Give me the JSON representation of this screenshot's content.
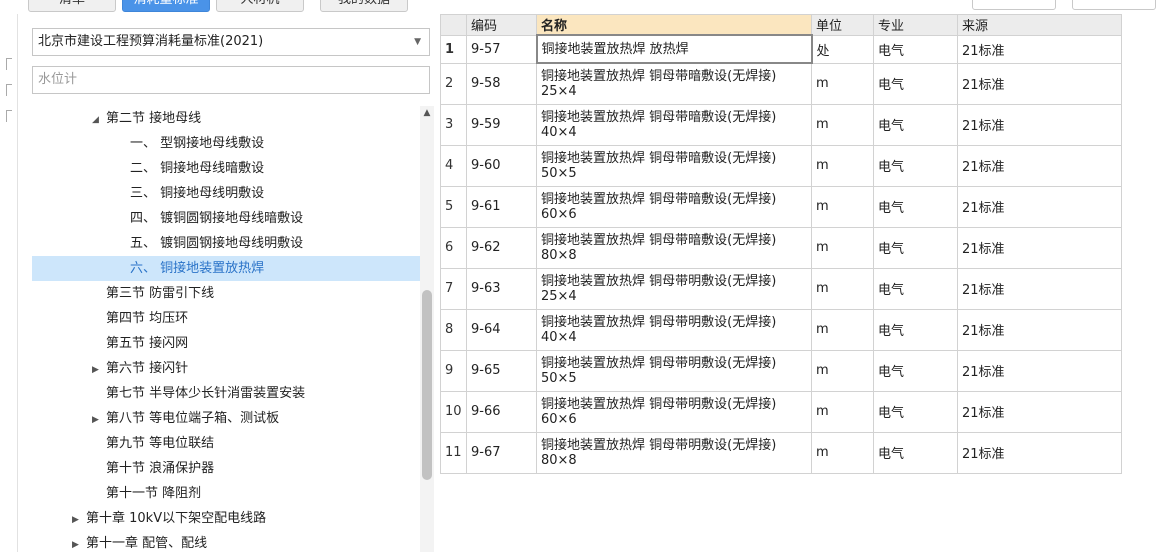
{
  "tabs": [
    "清单",
    "消耗量标准",
    "人材机",
    "我的数据"
  ],
  "quota_select": {
    "value": "北京市建设工程预算消耗量标准(2021)"
  },
  "search": {
    "placeholder": "水位计"
  },
  "tree": [
    {
      "label": "第二节 接地母线",
      "level": 1,
      "toggle": "expanded"
    },
    {
      "label": "一、 型钢接地母线敷设",
      "level": 2
    },
    {
      "label": "二、 铜接地母线暗敷设",
      "level": 2
    },
    {
      "label": "三、 铜接地母线明敷设",
      "level": 2
    },
    {
      "label": "四、 镀铜圆钢接地母线暗敷设",
      "level": 2
    },
    {
      "label": "五、 镀铜圆钢接地母线明敷设",
      "level": 2
    },
    {
      "label": "六、 铜接地装置放热焊",
      "level": 2,
      "selected": true
    },
    {
      "label": "第三节 防雷引下线",
      "level": 1
    },
    {
      "label": "第四节 均压环",
      "level": 1
    },
    {
      "label": "第五节 接闪网",
      "level": 1
    },
    {
      "label": "第六节 接闪针",
      "level": 1,
      "toggle": "collapsed"
    },
    {
      "label": "第七节 半导体少长针消雷装置安装",
      "level": 1
    },
    {
      "label": "第八节 等电位端子箱、测试板",
      "level": 1,
      "toggle": "collapsed"
    },
    {
      "label": "第九节 等电位联结",
      "level": 1
    },
    {
      "label": "第十节 浪涌保护器",
      "level": 1
    },
    {
      "label": "第十一节 降阻剂",
      "level": 1
    },
    {
      "label": "第十章 10kV以下架空配电线路",
      "level": 0,
      "toggle": "collapsed"
    },
    {
      "label": "第十一章 配管、配线",
      "level": 0,
      "toggle": "collapsed"
    }
  ],
  "table": {
    "columns": [
      "",
      "编码",
      "名称",
      "单位",
      "专业",
      "来源"
    ],
    "rows": [
      {
        "idx": "1",
        "code": "9-57",
        "name": "铜接地装置放热焊 放热焊",
        "unit": "处",
        "major": "电气",
        "source": "21标准"
      },
      {
        "idx": "2",
        "code": "9-58",
        "name": "铜接地装置放热焊 铜母带暗敷设(无焊接) 25×4",
        "unit": "m",
        "major": "电气",
        "source": "21标准"
      },
      {
        "idx": "3",
        "code": "9-59",
        "name": "铜接地装置放热焊 铜母带暗敷设(无焊接) 40×4",
        "unit": "m",
        "major": "电气",
        "source": "21标准"
      },
      {
        "idx": "4",
        "code": "9-60",
        "name": "铜接地装置放热焊 铜母带暗敷设(无焊接) 50×5",
        "unit": "m",
        "major": "电气",
        "source": "21标准"
      },
      {
        "idx": "5",
        "code": "9-61",
        "name": "铜接地装置放热焊 铜母带暗敷设(无焊接) 60×6",
        "unit": "m",
        "major": "电气",
        "source": "21标准"
      },
      {
        "idx": "6",
        "code": "9-62",
        "name": "铜接地装置放热焊 铜母带暗敷设(无焊接) 80×8",
        "unit": "m",
        "major": "电气",
        "source": "21标准"
      },
      {
        "idx": "7",
        "code": "9-63",
        "name": "铜接地装置放热焊 铜母带明敷设(无焊接) 25×4",
        "unit": "m",
        "major": "电气",
        "source": "21标准"
      },
      {
        "idx": "8",
        "code": "9-64",
        "name": "铜接地装置放热焊 铜母带明敷设(无焊接) 40×4",
        "unit": "m",
        "major": "电气",
        "source": "21标准"
      },
      {
        "idx": "9",
        "code": "9-65",
        "name": "铜接地装置放热焊 铜母带明敷设(无焊接) 50×5",
        "unit": "m",
        "major": "电气",
        "source": "21标准"
      },
      {
        "idx": "10",
        "code": "9-66",
        "name": "铜接地装置放热焊 铜母带明敷设(无焊接) 60×6",
        "unit": "m",
        "major": "电气",
        "source": "21标准"
      },
      {
        "idx": "11",
        "code": "9-67",
        "name": "铜接地装置放热焊 铜母带明敷设(无焊接) 80×8",
        "unit": "m",
        "major": "电气",
        "source": "21标准"
      }
    ]
  },
  "colors": {
    "accent": "#4a93e8",
    "selected_bg": "#cde6fb",
    "header_highlight": "#fbe6bf"
  }
}
